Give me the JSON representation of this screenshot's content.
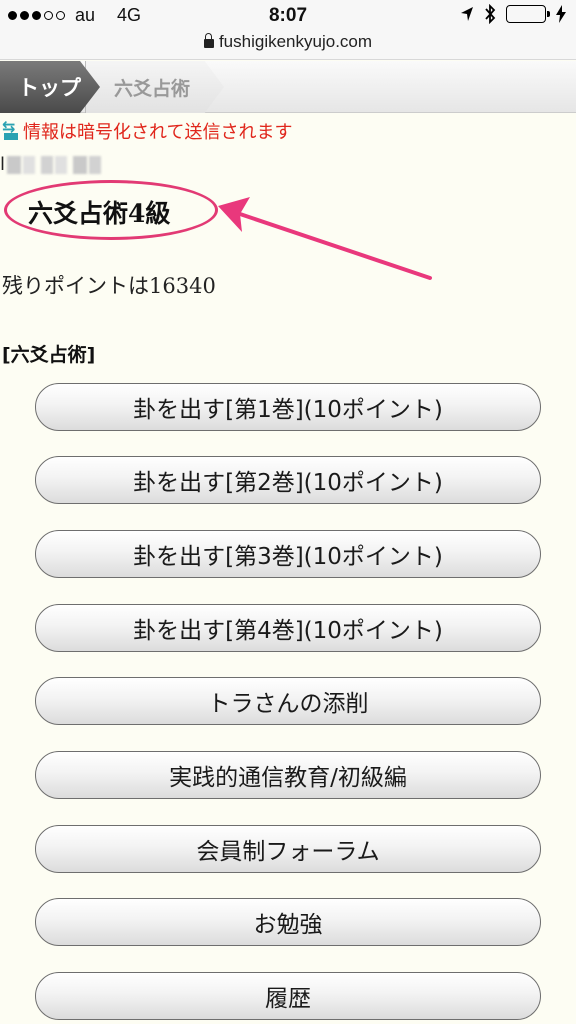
{
  "status_bar": {
    "carrier": "au",
    "network": "4G",
    "time": "8:07"
  },
  "url_bar": {
    "domain": "fushigikenkyujo.com"
  },
  "breadcrumb": {
    "home": "トップ",
    "current": "六爻占術"
  },
  "secure_notice": "情報は暗号化されて送信されます",
  "user": {
    "name_prefix": "l"
  },
  "rank": "六爻占術4級",
  "points_text": "残りポイントは16340",
  "section_title": "[六爻占術]",
  "buttons": [
    {
      "label": "卦を出す[第1巻](10ポイント)"
    },
    {
      "label": "卦を出す[第2巻](10ポイント)"
    },
    {
      "label": "卦を出す[第3巻](10ポイント)"
    },
    {
      "label": "卦を出す[第4巻](10ポイント)"
    },
    {
      "label": "トラさんの添削"
    },
    {
      "label": "実践的通信教育/初級編"
    },
    {
      "label": "会員制フォーラム"
    },
    {
      "label": "お勉強"
    },
    {
      "label": "履歴"
    }
  ],
  "colors": {
    "background": "#fdfdf3",
    "notice_red": "#e0261b",
    "highlight_pink": "#e23a74",
    "battery_green": "#4cd964"
  }
}
